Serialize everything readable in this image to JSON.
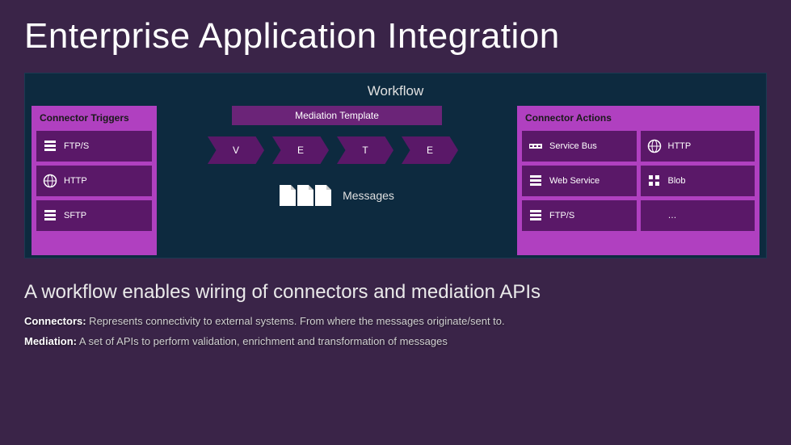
{
  "title": "Enterprise Application Integration",
  "workflow_label": "Workflow",
  "triggers": {
    "header": "Connector Triggers",
    "items": [
      {
        "label": "FTP/S",
        "icon": "server"
      },
      {
        "label": "HTTP",
        "icon": "globe"
      },
      {
        "label": "SFTP",
        "icon": "server"
      }
    ]
  },
  "mediation": {
    "header": "Mediation Template",
    "steps": [
      "V",
      "E",
      "T",
      "E"
    ]
  },
  "messages_label": "Messages",
  "actions": {
    "header": "Connector Actions",
    "items": [
      {
        "label": "Service Bus",
        "icon": "bus"
      },
      {
        "label": "HTTP",
        "icon": "globe"
      },
      {
        "label": "Web Service",
        "icon": "server"
      },
      {
        "label": "Blob",
        "icon": "blob"
      },
      {
        "label": "FTP/S",
        "icon": "server"
      },
      {
        "label": "…",
        "icon": "none"
      }
    ]
  },
  "subtitle": "A workflow enables wiring of connectors and mediation APIs",
  "definitions": {
    "connectors_term": "Connectors:",
    "connectors_text": " Represents connectivity to external systems. From where the messages originate/sent to.",
    "mediation_term": "Mediation:",
    "mediation_text": " A set of APIs to perform validation, enrichment and transformation of messages"
  }
}
